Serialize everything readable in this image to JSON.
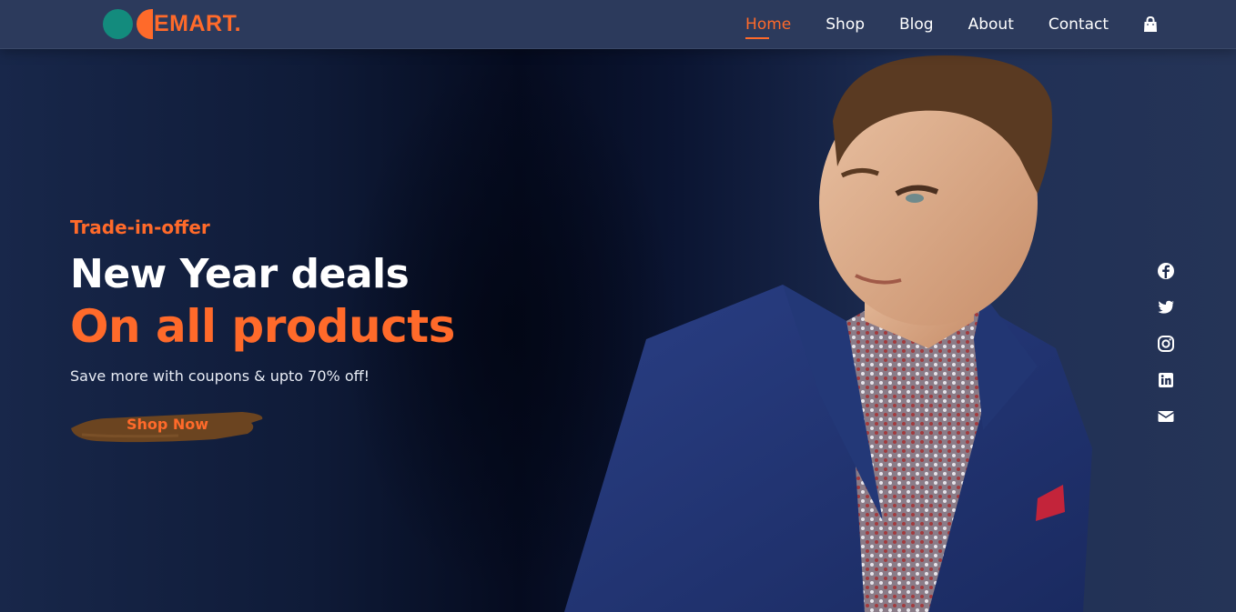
{
  "brand": {
    "logo_text": "EMART.",
    "colors": {
      "accent": "#ff6a2a",
      "teal": "#138b7d",
      "nav_bg": "#2c3a5c"
    }
  },
  "nav": {
    "items": [
      {
        "label": "Home",
        "active": true
      },
      {
        "label": "Shop"
      },
      {
        "label": "Blog"
      },
      {
        "label": "About"
      },
      {
        "label": "Contact"
      }
    ],
    "cart_icon": "shopping-bag-icon"
  },
  "hero": {
    "tagline": "Trade-in-offer",
    "headline": "New Year deals",
    "subheadline": "On all products",
    "description": "Save more with coupons & upto 70% off!",
    "cta_label": "Shop Now"
  },
  "social": {
    "icons": [
      "facebook-icon",
      "twitter-icon",
      "instagram-icon",
      "linkedin-icon",
      "envelope-icon"
    ]
  }
}
